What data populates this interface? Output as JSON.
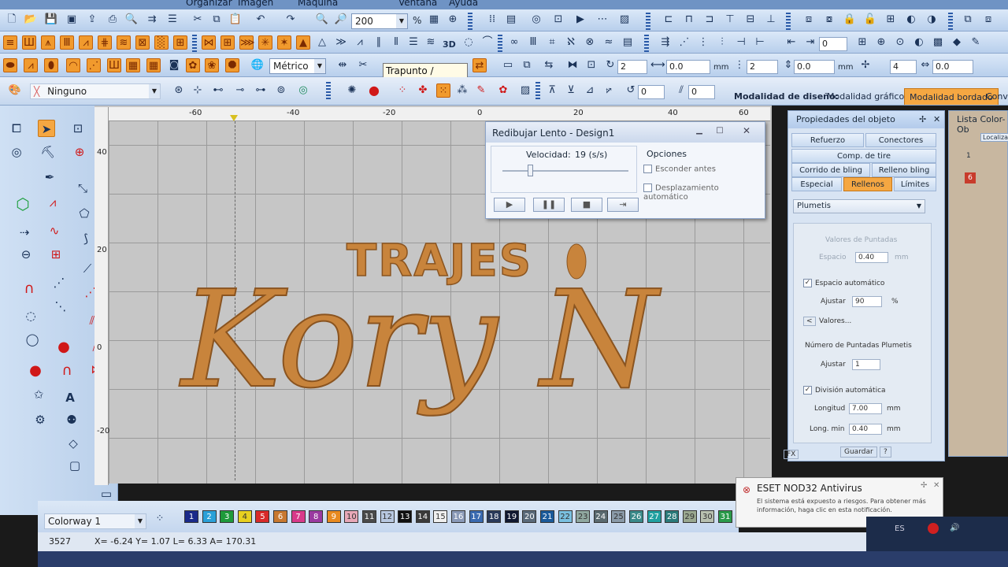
{
  "menubar": [
    "Organizar",
    "Imagen",
    "Máquina",
    "Ventana",
    "Ayuda"
  ],
  "toolbar": {
    "zoom_value": "200",
    "zoom_unit": "%",
    "units": "Métrico",
    "tooltip": "Trapunto / Valores",
    "mode_label": "Modalidad de diseño:",
    "mode_graficos": "Modalidad gráficos",
    "mode_bordado": "Modalidad bordado",
    "mode_extra": "Conve",
    "fill_style": "Ninguno",
    "field_0": "0",
    "field_00": "0.0",
    "field_2": "2",
    "field_4": "4",
    "unit_mm": "mm",
    "label_3d": "3D",
    "angle_a": "0",
    "angle_b": "0"
  },
  "ruler": {
    "h": [
      "-60",
      "-40",
      "-20",
      "0",
      "20",
      "40",
      "60"
    ],
    "v": [
      "40",
      "20",
      "0",
      "-20"
    ]
  },
  "design": {
    "line1": "TRAJES",
    "line2": "Kory N"
  },
  "dialog": {
    "title": "Redibujar Lento - Design1",
    "speed_label": "Velocidad:",
    "speed_value": "19 (s/s)",
    "speed_fraction": 0.2,
    "options_label": "Opciones",
    "opt_hide": "Esconder antes",
    "opt_autoscroll": "Desplazamiento automático"
  },
  "props": {
    "title": "Propiedades del objeto",
    "tabs": [
      "Refuerzo",
      "Conectores",
      "Comp. de tire",
      "Corrido de bling",
      "Relleno bling",
      "Especial",
      "Rellenos",
      "Límites"
    ],
    "active_tab": "Rellenos",
    "fill_type": "Plumetis",
    "valores_puntadas": "Valores de Puntadas",
    "espacio_label": "Espacio",
    "espacio_value": "0.40",
    "unit_mm": "mm",
    "espacio_auto": "Espacio automático",
    "ajustar_label": "Ajustar",
    "ajustar_value": "90",
    "percent": "%",
    "valores_btn": "Valores...",
    "num_puntadas": "Número de Puntadas Plumetis",
    "ajustar2_value": "1",
    "division_auto": "División automática",
    "longitud_label": "Longitud",
    "longitud_value": "7.00",
    "long_min_label": "Long. min",
    "long_min_value": "0.40",
    "fx": "FX",
    "guardar": "Guardar",
    "help": "?"
  },
  "colorpanel": {
    "title": "Lista Color-Ob",
    "localizar": "Localizar",
    "item_num": "1",
    "item_code": "6"
  },
  "palette": {
    "colorway": "Colorway 1",
    "swatches": [
      {
        "n": "1",
        "c": "#1a2a8a",
        "t": "#fff"
      },
      {
        "n": "2",
        "c": "#2aa0d8",
        "t": "#fff"
      },
      {
        "n": "3",
        "c": "#1e9a3a",
        "t": "#fff"
      },
      {
        "n": "4",
        "c": "#e8d020",
        "t": "#333"
      },
      {
        "n": "5",
        "c": "#d82a2a",
        "t": "#fff"
      },
      {
        "n": "6",
        "c": "#c87830",
        "t": "#fff"
      },
      {
        "n": "7",
        "c": "#d83a8a",
        "t": "#fff"
      },
      {
        "n": "8",
        "c": "#9a3aa0",
        "t": "#fff"
      },
      {
        "n": "9",
        "c": "#e88a20",
        "t": "#fff"
      },
      {
        "n": "10",
        "c": "#e8a8b8",
        "t": "#333"
      },
      {
        "n": "11",
        "c": "#4a4a4a",
        "t": "#fff"
      },
      {
        "n": "12",
        "c": "#b8c8e0",
        "t": "#333"
      },
      {
        "n": "13",
        "c": "#101010",
        "t": "#fff"
      },
      {
        "n": "14",
        "c": "#3a3a3a",
        "t": "#fff"
      },
      {
        "n": "15",
        "c": "#f0f0f0",
        "t": "#333"
      },
      {
        "n": "16",
        "c": "#8a9ab8",
        "t": "#fff"
      },
      {
        "n": "17",
        "c": "#3a6ab0",
        "t": "#fff"
      },
      {
        "n": "18",
        "c": "#2a3a5a",
        "t": "#fff"
      },
      {
        "n": "19",
        "c": "#101830",
        "t": "#fff"
      },
      {
        "n": "20",
        "c": "#5a6a7a",
        "t": "#fff"
      },
      {
        "n": "21",
        "c": "#1a5a9a",
        "t": "#fff"
      },
      {
        "n": "22",
        "c": "#7ac0e0",
        "t": "#333"
      },
      {
        "n": "23",
        "c": "#90a8a0",
        "t": "#333"
      },
      {
        "n": "24",
        "c": "#5a6a70",
        "t": "#fff"
      },
      {
        "n": "25",
        "c": "#8a9aa8",
        "t": "#333"
      },
      {
        "n": "26",
        "c": "#3a8a8a",
        "t": "#fff"
      },
      {
        "n": "27",
        "c": "#20a0a0",
        "t": "#fff"
      },
      {
        "n": "28",
        "c": "#2a7a7a",
        "t": "#fff"
      },
      {
        "n": "29",
        "c": "#9aa890",
        "t": "#333"
      },
      {
        "n": "30",
        "c": "#b8c0b0",
        "t": "#333"
      },
      {
        "n": "31",
        "c": "#2a9a4a",
        "t": "#fff"
      }
    ]
  },
  "status": {
    "stitches": "3527",
    "coords": "X= -6.24 Y= 1.07 L= 6.33 A= 170.31"
  },
  "eset": {
    "title": "ESET NOD32 Antivirus",
    "body": "El sistema está expuesto a riesgos. Para obtener más información, haga clic en esta notificación."
  },
  "tray": {
    "lang": "ES"
  },
  "colors": {
    "accent": "#f5a742",
    "thread": "#c8843c"
  }
}
